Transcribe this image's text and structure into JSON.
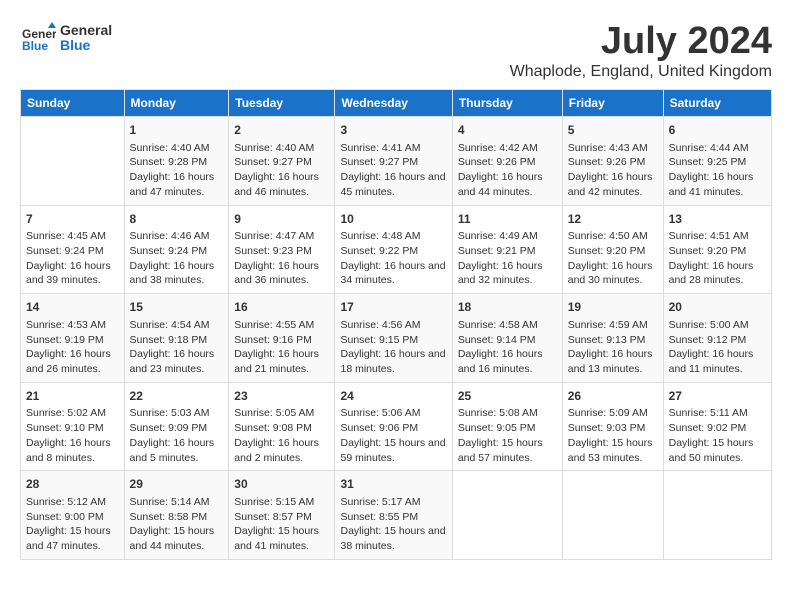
{
  "header": {
    "logo_general": "General",
    "logo_blue": "Blue",
    "title": "July 2024",
    "subtitle": "Whaplode, England, United Kingdom"
  },
  "days_of_week": [
    "Sunday",
    "Monday",
    "Tuesday",
    "Wednesday",
    "Thursday",
    "Friday",
    "Saturday"
  ],
  "weeks": [
    [
      {
        "day": "",
        "info": ""
      },
      {
        "day": "1",
        "info": "Sunrise: 4:40 AM\nSunset: 9:28 PM\nDaylight: 16 hours and 47 minutes."
      },
      {
        "day": "2",
        "info": "Sunrise: 4:40 AM\nSunset: 9:27 PM\nDaylight: 16 hours and 46 minutes."
      },
      {
        "day": "3",
        "info": "Sunrise: 4:41 AM\nSunset: 9:27 PM\nDaylight: 16 hours and 45 minutes."
      },
      {
        "day": "4",
        "info": "Sunrise: 4:42 AM\nSunset: 9:26 PM\nDaylight: 16 hours and 44 minutes."
      },
      {
        "day": "5",
        "info": "Sunrise: 4:43 AM\nSunset: 9:26 PM\nDaylight: 16 hours and 42 minutes."
      },
      {
        "day": "6",
        "info": "Sunrise: 4:44 AM\nSunset: 9:25 PM\nDaylight: 16 hours and 41 minutes."
      }
    ],
    [
      {
        "day": "7",
        "info": "Sunrise: 4:45 AM\nSunset: 9:24 PM\nDaylight: 16 hours and 39 minutes."
      },
      {
        "day": "8",
        "info": "Sunrise: 4:46 AM\nSunset: 9:24 PM\nDaylight: 16 hours and 38 minutes."
      },
      {
        "day": "9",
        "info": "Sunrise: 4:47 AM\nSunset: 9:23 PM\nDaylight: 16 hours and 36 minutes."
      },
      {
        "day": "10",
        "info": "Sunrise: 4:48 AM\nSunset: 9:22 PM\nDaylight: 16 hours and 34 minutes."
      },
      {
        "day": "11",
        "info": "Sunrise: 4:49 AM\nSunset: 9:21 PM\nDaylight: 16 hours and 32 minutes."
      },
      {
        "day": "12",
        "info": "Sunrise: 4:50 AM\nSunset: 9:20 PM\nDaylight: 16 hours and 30 minutes."
      },
      {
        "day": "13",
        "info": "Sunrise: 4:51 AM\nSunset: 9:20 PM\nDaylight: 16 hours and 28 minutes."
      }
    ],
    [
      {
        "day": "14",
        "info": "Sunrise: 4:53 AM\nSunset: 9:19 PM\nDaylight: 16 hours and 26 minutes."
      },
      {
        "day": "15",
        "info": "Sunrise: 4:54 AM\nSunset: 9:18 PM\nDaylight: 16 hours and 23 minutes."
      },
      {
        "day": "16",
        "info": "Sunrise: 4:55 AM\nSunset: 9:16 PM\nDaylight: 16 hours and 21 minutes."
      },
      {
        "day": "17",
        "info": "Sunrise: 4:56 AM\nSunset: 9:15 PM\nDaylight: 16 hours and 18 minutes."
      },
      {
        "day": "18",
        "info": "Sunrise: 4:58 AM\nSunset: 9:14 PM\nDaylight: 16 hours and 16 minutes."
      },
      {
        "day": "19",
        "info": "Sunrise: 4:59 AM\nSunset: 9:13 PM\nDaylight: 16 hours and 13 minutes."
      },
      {
        "day": "20",
        "info": "Sunrise: 5:00 AM\nSunset: 9:12 PM\nDaylight: 16 hours and 11 minutes."
      }
    ],
    [
      {
        "day": "21",
        "info": "Sunrise: 5:02 AM\nSunset: 9:10 PM\nDaylight: 16 hours and 8 minutes."
      },
      {
        "day": "22",
        "info": "Sunrise: 5:03 AM\nSunset: 9:09 PM\nDaylight: 16 hours and 5 minutes."
      },
      {
        "day": "23",
        "info": "Sunrise: 5:05 AM\nSunset: 9:08 PM\nDaylight: 16 hours and 2 minutes."
      },
      {
        "day": "24",
        "info": "Sunrise: 5:06 AM\nSunset: 9:06 PM\nDaylight: 15 hours and 59 minutes."
      },
      {
        "day": "25",
        "info": "Sunrise: 5:08 AM\nSunset: 9:05 PM\nDaylight: 15 hours and 57 minutes."
      },
      {
        "day": "26",
        "info": "Sunrise: 5:09 AM\nSunset: 9:03 PM\nDaylight: 15 hours and 53 minutes."
      },
      {
        "day": "27",
        "info": "Sunrise: 5:11 AM\nSunset: 9:02 PM\nDaylight: 15 hours and 50 minutes."
      }
    ],
    [
      {
        "day": "28",
        "info": "Sunrise: 5:12 AM\nSunset: 9:00 PM\nDaylight: 15 hours and 47 minutes."
      },
      {
        "day": "29",
        "info": "Sunrise: 5:14 AM\nSunset: 8:58 PM\nDaylight: 15 hours and 44 minutes."
      },
      {
        "day": "30",
        "info": "Sunrise: 5:15 AM\nSunset: 8:57 PM\nDaylight: 15 hours and 41 minutes."
      },
      {
        "day": "31",
        "info": "Sunrise: 5:17 AM\nSunset: 8:55 PM\nDaylight: 15 hours and 38 minutes."
      },
      {
        "day": "",
        "info": ""
      },
      {
        "day": "",
        "info": ""
      },
      {
        "day": "",
        "info": ""
      }
    ]
  ]
}
